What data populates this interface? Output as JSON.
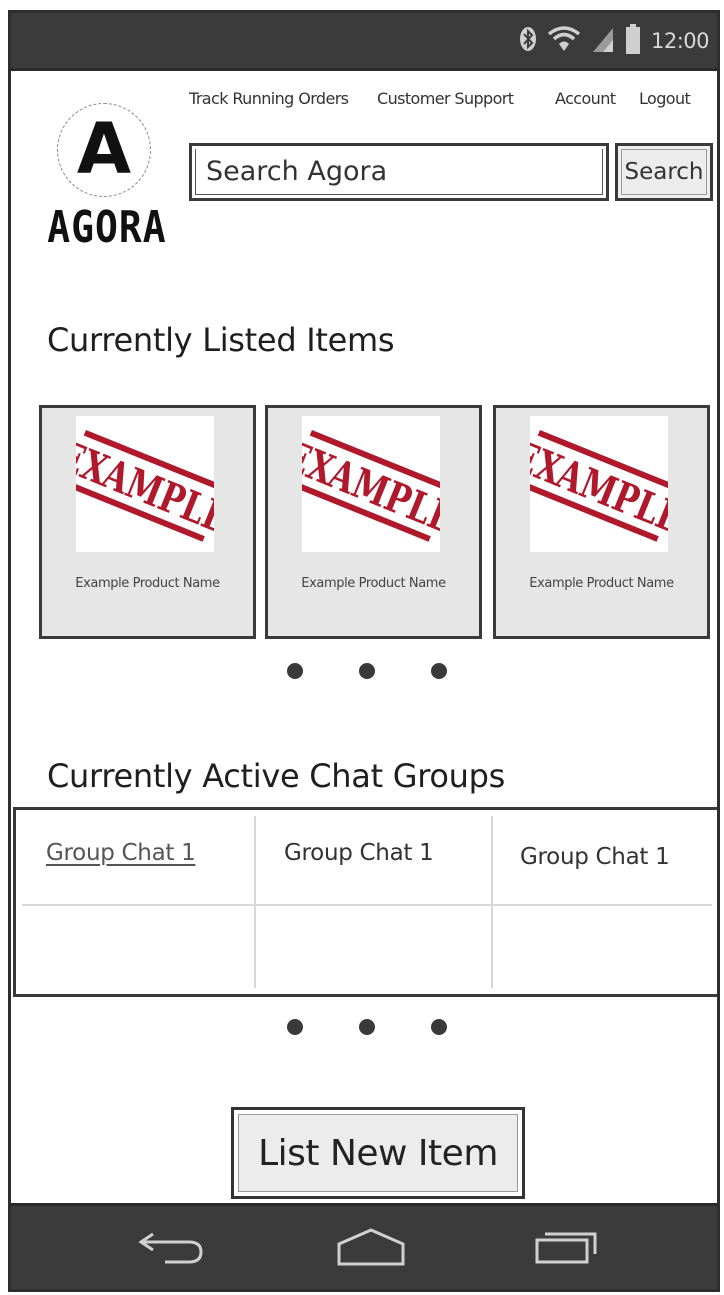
{
  "status_bar": {
    "time": "12:00",
    "icons": [
      "bluetooth-icon",
      "wifi-icon",
      "signal-icon",
      "battery-icon"
    ]
  },
  "header": {
    "logo_letter": "A",
    "logo_wordmark": "AGORA",
    "nav": {
      "track_orders": "Track Running Orders",
      "customer_support": "Customer Support",
      "account": "Account",
      "logout": "Logout"
    },
    "search": {
      "placeholder": "Search Agora",
      "button_label": "Search"
    }
  },
  "listed_items": {
    "title": "Currently Listed Items",
    "items": [
      {
        "image_text": "EXAMPLE",
        "name": "Example Product Name"
      },
      {
        "image_text": "EXAMPLE",
        "name": "Example Product Name"
      },
      {
        "image_text": "EXAMPLE",
        "name": "Example Product Name"
      }
    ],
    "pager_dots": 3
  },
  "chat_groups": {
    "title": "Currently Active Chat Groups",
    "groups": [
      "Group Chat 1",
      "Group Chat 1",
      "Group Chat 1"
    ],
    "pager_dots": 3
  },
  "actions": {
    "list_new_item": "List New Item"
  },
  "nav_bar": {
    "icons": [
      "back-icon",
      "home-icon",
      "recent-apps-icon"
    ]
  },
  "colors": {
    "bars": "#3b3b3b",
    "card_bg": "#e6e6e6",
    "stamp_red": "#b0182b"
  }
}
